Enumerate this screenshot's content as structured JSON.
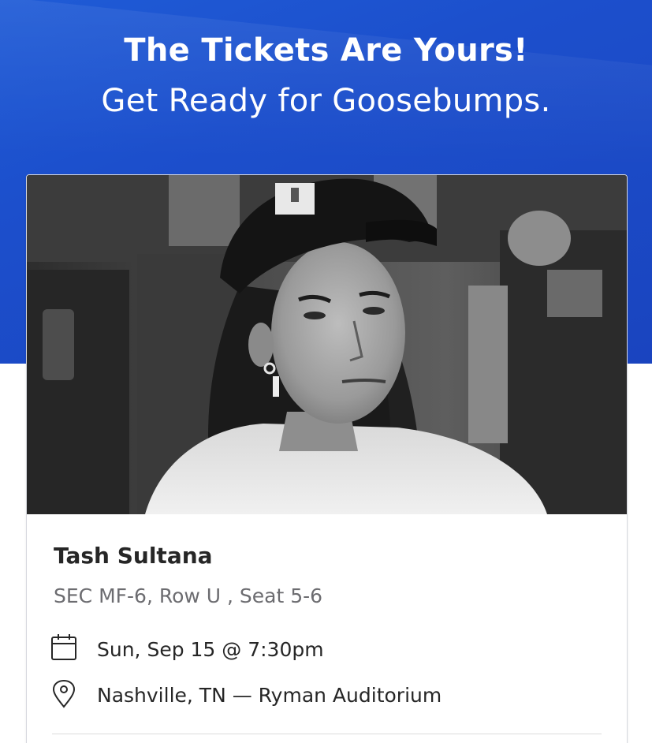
{
  "header": {
    "title": "The Tickets Are Yours!",
    "subtitle": "Get Ready for Goosebumps."
  },
  "ticket": {
    "artist": "Tash Sultana",
    "seat_info": "SEC MF-6, Row U , Seat 5-6",
    "date_time": "Sun, Sep 15 @ 7:30pm",
    "location": "Nashville, TN — Ryman Auditorium",
    "date_icon": "calendar-icon",
    "location_icon": "map-pin-icon"
  },
  "colors": {
    "hero_blue": "#1c4fcc",
    "text_dark": "#262626",
    "text_muted": "#6c6c70"
  }
}
